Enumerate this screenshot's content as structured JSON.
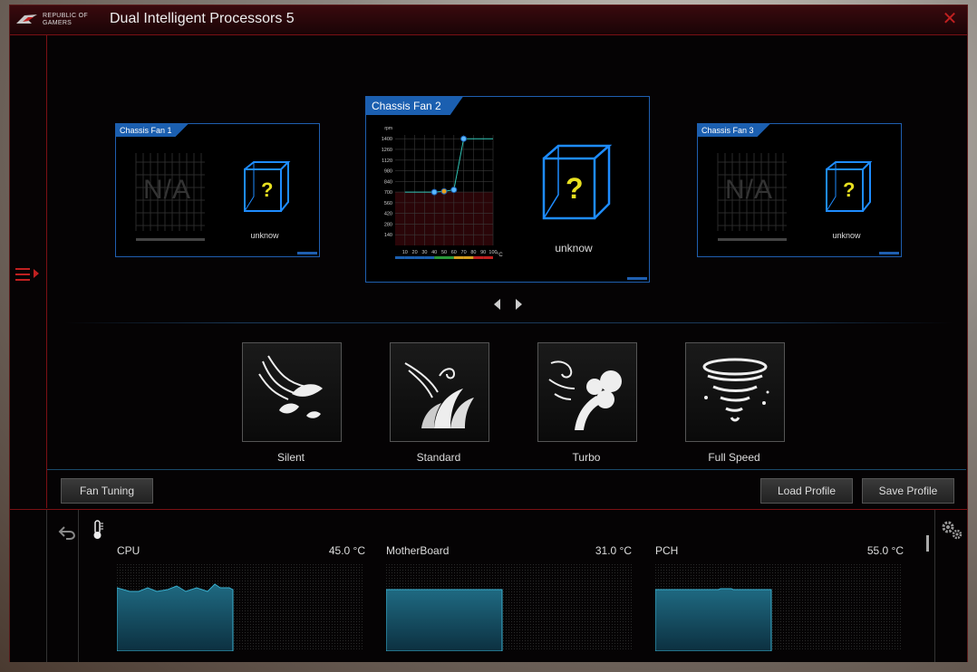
{
  "window": {
    "logo_text": "REPUBLIC OF GAMERS",
    "title": "Dual Intelligent Processors 5",
    "close_icon": "close-icon"
  },
  "fans": [
    {
      "name": "Chassis Fan 1",
      "status": "unknow",
      "graph_text": "N/A"
    },
    {
      "name": "Chassis Fan 2",
      "status": "unknow"
    },
    {
      "name": "Chassis Fan 3",
      "status": "unknow",
      "graph_text": "N/A"
    }
  ],
  "fan_chart": {
    "rpm_label": "rpm",
    "unit_label": "°C",
    "y_ticks": [
      "1400",
      "1260",
      "1120",
      "980",
      "840",
      "700",
      "560",
      "420",
      "280",
      "140"
    ],
    "x_ticks": [
      "10",
      "20",
      "30",
      "40",
      "50",
      "60",
      "70",
      "80",
      "90",
      "100"
    ]
  },
  "chart_data": {
    "type": "line",
    "title": "",
    "xlabel": "°C",
    "ylabel": "rpm",
    "x": [
      10,
      40,
      50,
      60,
      70,
      80,
      100
    ],
    "y": [
      700,
      700,
      710,
      730,
      1400,
      1400,
      1400
    ],
    "control_points": [
      [
        40,
        700
      ],
      [
        50,
        710
      ],
      [
        60,
        730
      ],
      [
        70,
        1400
      ]
    ],
    "xlim": [
      0,
      100
    ],
    "ylim": [
      0,
      1450
    ]
  },
  "modes": [
    {
      "label": "Silent",
      "icon": "silent-leaves-icon"
    },
    {
      "label": "Standard",
      "icon": "standard-wind-icon"
    },
    {
      "label": "Turbo",
      "icon": "turbo-wind-icon"
    },
    {
      "label": "Full Speed",
      "icon": "tornado-icon"
    }
  ],
  "buttons": {
    "fan_tuning": "Fan Tuning",
    "load_profile": "Load Profile",
    "save_profile": "Save Profile"
  },
  "temps": [
    {
      "name": "CPU",
      "value": "45.0 °C"
    },
    {
      "name": "MotherBoard",
      "value": "31.0 °C"
    },
    {
      "name": "PCH",
      "value": "55.0 °C"
    }
  ],
  "colors": {
    "accent": "#1f5fb0",
    "brand_red": "#c02020",
    "graph": "#2a8aa8"
  }
}
